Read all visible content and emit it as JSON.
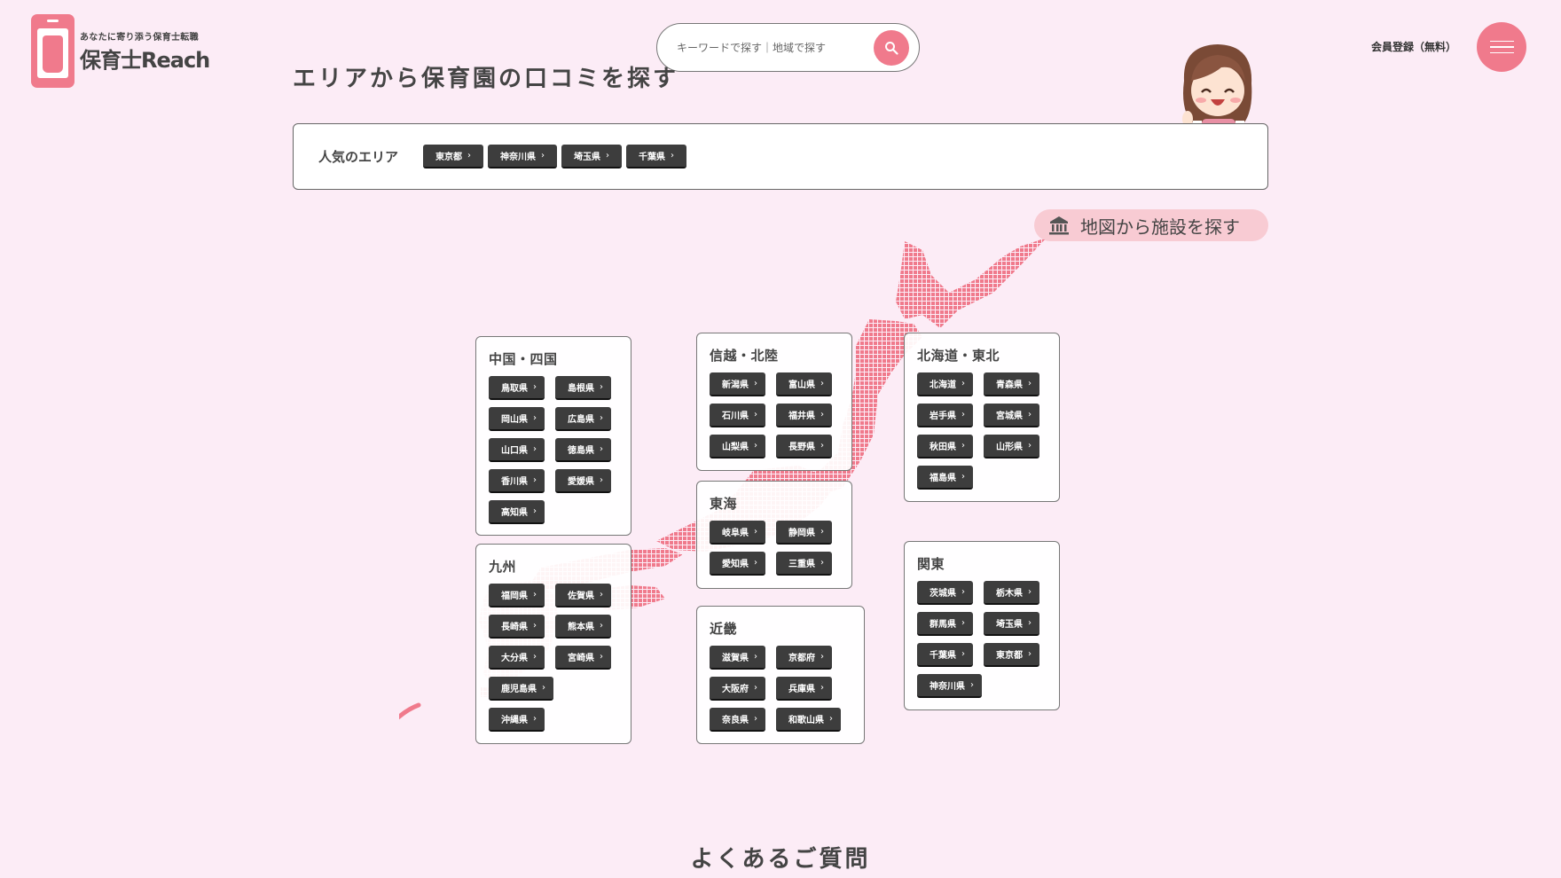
{
  "header": {
    "logo_sub": "あなたに寄り添う保育士転職",
    "logo_main": "保育士Reach",
    "search_placeholder": "キーワードで探す｜地域で探す",
    "signup": "会員登録（無料）"
  },
  "section": {
    "title": "エリアから保育園の口コミを探す",
    "popular_label": "人気のエリア",
    "popular": [
      "東京都",
      "神奈川県",
      "埼玉県",
      "千葉県"
    ],
    "map_link": "地図から施設を探す"
  },
  "regions": {
    "chugoku_shikoku": {
      "name": "中国・四国",
      "prefs": [
        "鳥取県",
        "島根県",
        "岡山県",
        "広島県",
        "山口県",
        "徳島県",
        "香川県",
        "愛媛県",
        "高知県"
      ]
    },
    "kyushu": {
      "name": "九州",
      "prefs": [
        "福岡県",
        "佐賀県",
        "長崎県",
        "熊本県",
        "大分県",
        "宮崎県",
        "鹿児島県",
        "沖縄県"
      ]
    },
    "shinetsu_hokuriku": {
      "name": "信越・北陸",
      "prefs": [
        "新潟県",
        "富山県",
        "石川県",
        "福井県",
        "山梨県",
        "長野県"
      ]
    },
    "tokai": {
      "name": "東海",
      "prefs": [
        "岐阜県",
        "静岡県",
        "愛知県",
        "三重県"
      ]
    },
    "kinki": {
      "name": "近畿",
      "prefs": [
        "滋賀県",
        "京都府",
        "大阪府",
        "兵庫県",
        "奈良県",
        "和歌山県"
      ]
    },
    "hokkaido_tohoku": {
      "name": "北海道・東北",
      "prefs": [
        "北海道",
        "青森県",
        "岩手県",
        "宮城県",
        "秋田県",
        "山形県",
        "福島県"
      ]
    },
    "kanto": {
      "name": "関東",
      "prefs": [
        "茨城県",
        "栃木県",
        "群馬県",
        "埼玉県",
        "千葉県",
        "東京都",
        "神奈川県"
      ]
    }
  },
  "faq": {
    "title": "よくあるご質問"
  },
  "colors": {
    "background": "#fcecf6",
    "accent": "#f07a8c",
    "tag": "#3d3d3d"
  },
  "icons": {
    "search": "search-icon",
    "menu": "hamburger-icon",
    "map": "building-icon",
    "chevron": "chevron-right-icon"
  }
}
